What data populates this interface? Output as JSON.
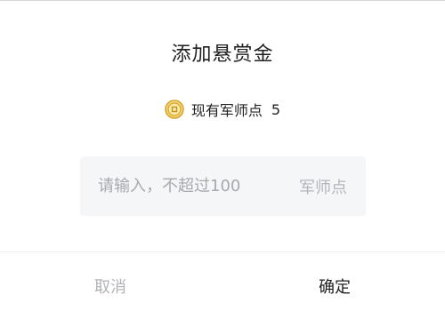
{
  "dialog": {
    "title": "添加悬赏金",
    "balance_label": "现有军师点",
    "balance_value": "5",
    "input_placeholder": "请输入，不超过100",
    "unit": "军师点",
    "cancel_label": "取消",
    "confirm_label": "确定"
  },
  "colors": {
    "coin": "#d4a62a",
    "input_bg": "#f5f6f8",
    "cancel_text": "#b1b3b7",
    "confirm_text": "#1f1f1f"
  },
  "icons": {
    "balance": "coin-icon"
  }
}
